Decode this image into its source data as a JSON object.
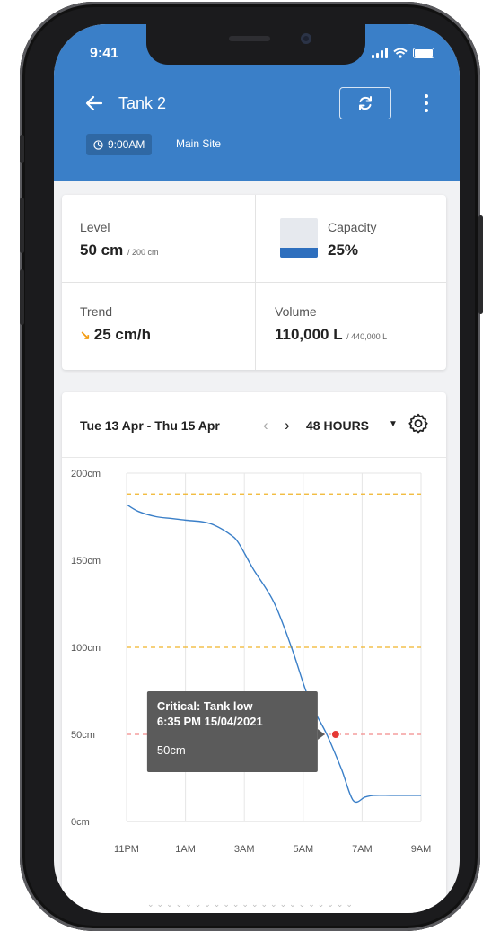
{
  "status_bar": {
    "time": "9:41"
  },
  "header": {
    "title": "Tank 2",
    "time_chip": "9:00AM",
    "site": "Main Site",
    "back_icon": "arrow-left-icon",
    "refresh_icon": "refresh-icon",
    "more_icon": "more-vertical-icon",
    "bg_color": "#3a7fc8"
  },
  "stats": {
    "level": {
      "label": "Level",
      "value": "50 cm",
      "sub": "/ 200 cm"
    },
    "capacity": {
      "label": "Capacity",
      "value": "25%",
      "fill_fraction": 0.25
    },
    "trend": {
      "label": "Trend",
      "value": "25 cm/h",
      "icon": "arrow-down-right-icon",
      "icon_color": "#f39c12"
    },
    "volume": {
      "label": "Volume",
      "value": "110,000 L",
      "sub": "/ 440,000 L"
    }
  },
  "chart_controls": {
    "range": "Tue 13 Apr - Thu 15 Apr",
    "period": "48 HOURS",
    "prev_icon": "chevron-left-icon",
    "next_icon": "chevron-right-icon",
    "settings_icon": "gear-icon"
  },
  "tooltip": {
    "title": "Critical: Tank low",
    "datetime": "6:35 PM 15/04/2021",
    "value": "50cm"
  },
  "chart_data": {
    "type": "line",
    "y_ticks": [
      "0cm",
      "50cm",
      "100cm",
      "150cm",
      "200cm"
    ],
    "ylim": [
      0,
      200
    ],
    "x_ticks": [
      "11PM",
      "1AM",
      "3AM",
      "5AM",
      "7AM",
      "9AM"
    ],
    "x_tick_hours": [
      0,
      2,
      4,
      6,
      8,
      10
    ],
    "xlim_hours": [
      0,
      10
    ],
    "thresholds": [
      {
        "value": 188,
        "color": "#f0b429"
      },
      {
        "value": 100,
        "color": "#f0b429"
      },
      {
        "value": 50,
        "color": "#f28b8b"
      }
    ],
    "series": [
      {
        "color": "#3a7fc8",
        "x_hours": [
          0,
          0.4,
          1,
          1.5,
          2,
          2.6,
          3,
          3.5,
          3.8,
          4.3,
          5,
          5.6,
          6.2,
          6.8,
          7.3,
          7.7,
          8.1,
          8.4,
          9,
          9.6,
          10
        ],
        "values": [
          182,
          178,
          175,
          174,
          173,
          172,
          170,
          165,
          160,
          145,
          126,
          100,
          70,
          50,
          30,
          12,
          14,
          15,
          15,
          15,
          15
        ]
      }
    ],
    "highlight": {
      "x_hours": 7.1,
      "value": 50,
      "color": "#e53935"
    }
  }
}
